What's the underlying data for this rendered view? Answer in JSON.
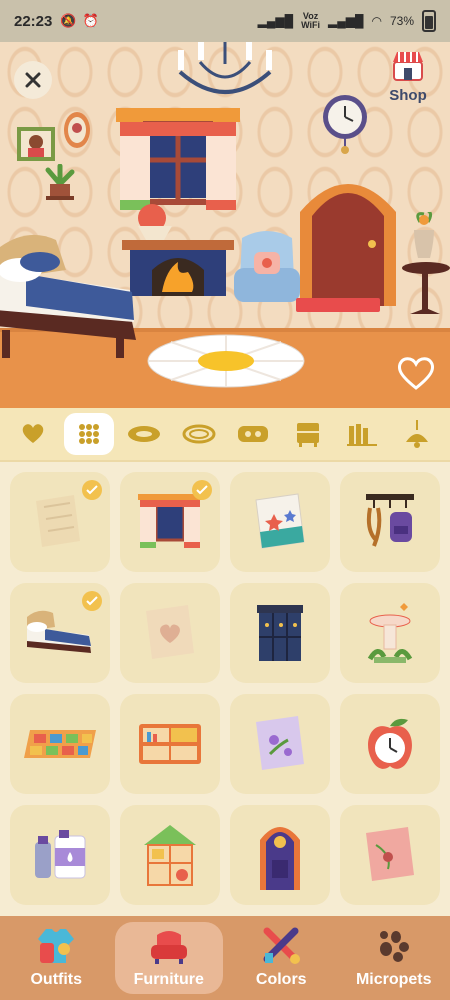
{
  "status_bar": {
    "time": "22:23",
    "network_top": "Voz",
    "network_bottom": "WiFi",
    "battery": "73"
  },
  "room": {
    "shop_label": "Shop"
  },
  "categories": [
    {
      "icon": "heart-icon"
    },
    {
      "icon": "grid-icon",
      "active": true
    },
    {
      "icon": "rug-oval-icon"
    },
    {
      "icon": "rug-round-icon"
    },
    {
      "icon": "rug-hearts-icon"
    },
    {
      "icon": "dresser-icon"
    },
    {
      "icon": "books-icon"
    },
    {
      "icon": "lamp-icon"
    }
  ],
  "grid_items": [
    {
      "icon": "wallpaper-icon",
      "selected": true
    },
    {
      "icon": "window-curtain-icon",
      "selected": true
    },
    {
      "icon": "wallpaper-stars-icon"
    },
    {
      "icon": "coat-rack-icon"
    },
    {
      "icon": "bed-icon",
      "selected": true
    },
    {
      "icon": "wallpaper-heart-icon"
    },
    {
      "icon": "cabinet-icon"
    },
    {
      "icon": "birdbath-icon"
    },
    {
      "icon": "color-rug-icon"
    },
    {
      "icon": "shelf-icon"
    },
    {
      "icon": "wallpaper-flower-icon"
    },
    {
      "icon": "apple-clock-icon"
    },
    {
      "icon": "bottles-icon"
    },
    {
      "icon": "dollhouse-icon"
    },
    {
      "icon": "door-icon"
    },
    {
      "icon": "wallpaper-pink-icon"
    }
  ],
  "bottom_nav": [
    {
      "label": "Outfits",
      "icon": "outfits-icon"
    },
    {
      "label": "Furniture",
      "icon": "furniture-icon",
      "active": true
    },
    {
      "label": "Colors",
      "icon": "colors-icon"
    },
    {
      "label": "Micropets",
      "icon": "micropets-icon"
    }
  ],
  "colors": {
    "accent": "#d89968",
    "tab_bar": "#f5e6b8",
    "card": "#f1e4bc",
    "check": "#f2c14e"
  }
}
